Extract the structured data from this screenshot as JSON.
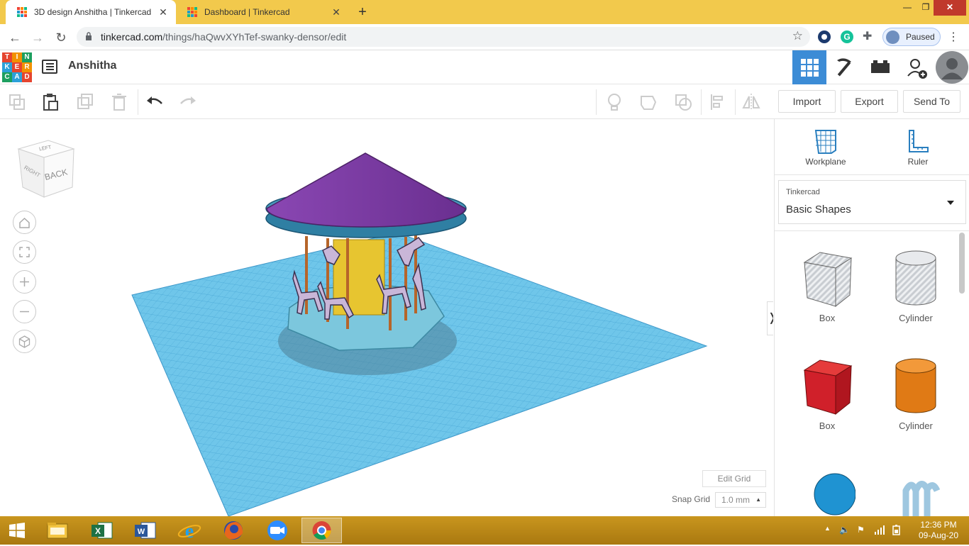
{
  "browser": {
    "tabs": [
      {
        "title": "3D design Anshitha | Tinkercad",
        "active": true
      },
      {
        "title": "Dashboard | Tinkercad",
        "active": false
      }
    ],
    "url_domain": "tinkercad.com",
    "url_path": "/things/haQwvXYhTef-swanky-densor/edit",
    "profile_status": "Paused"
  },
  "tinkercad": {
    "logo_letters": [
      "T",
      "I",
      "N",
      "K",
      "E",
      "R",
      "C",
      "A",
      "D"
    ],
    "design_name": "Anshitha",
    "actions": {
      "import": "Import",
      "export": "Export",
      "send_to": "Send To"
    },
    "view_cube": {
      "face_front": "BACK",
      "face_side": "RIGHT",
      "face_top": "LEFT"
    },
    "panel": {
      "workplane": "Workplane",
      "ruler": "Ruler",
      "library_source": "Tinkercad",
      "library_selected": "Basic Shapes",
      "shapes": [
        {
          "label": "Box",
          "kind": "box-hole"
        },
        {
          "label": "Cylinder",
          "kind": "cylinder-hole"
        },
        {
          "label": "Box",
          "kind": "box-solid"
        },
        {
          "label": "Cylinder",
          "kind": "cylinder-solid"
        }
      ]
    },
    "grid": {
      "edit_label": "Edit Grid",
      "snap_label": "Snap Grid",
      "snap_value": "1.0 mm"
    }
  },
  "colors": {
    "tab_strip": "#f2c94c",
    "accent": "#3c8cd6",
    "workplane": "#6fc6ea",
    "roof": "#7b3fa0",
    "center_pole": "#e7c530",
    "base": "#7cc7dd",
    "box_solid": "#d0202a",
    "cylinder_solid": "#e07a15",
    "sphere": "#1f93d2"
  },
  "taskbar": {
    "time": "12:36 PM",
    "date": "09-Aug-20"
  }
}
